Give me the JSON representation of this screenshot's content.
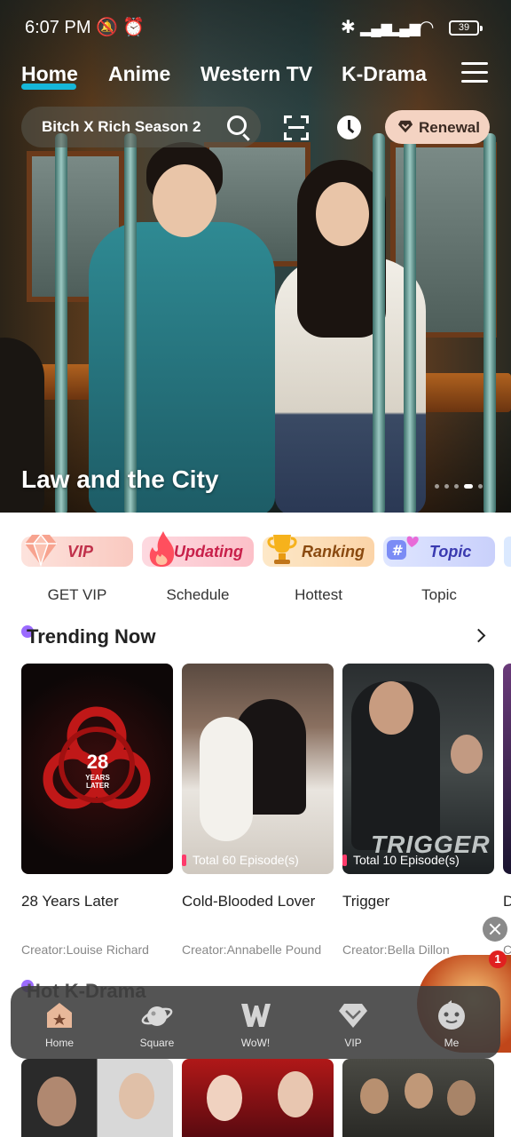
{
  "status_bar": {
    "time": "6:07 PM",
    "battery": "39"
  },
  "top_nav": {
    "tabs": [
      "Home",
      "Anime",
      "Western TV",
      "K-Drama"
    ],
    "active_tab": "Home"
  },
  "search": {
    "query": "Bitch X Rich Season 2"
  },
  "renewal_button": {
    "label": "Renewal"
  },
  "hero": {
    "title": "Law and the City",
    "slide_count": 5,
    "active_slide": 4
  },
  "quick_links": [
    {
      "badge": "VIP",
      "label": "GET VIP",
      "icon": "diamond-icon"
    },
    {
      "badge": "Updating",
      "label": "Schedule",
      "icon": "flame-icon"
    },
    {
      "badge": "Ranking",
      "label": "Hottest",
      "icon": "trophy-icon"
    },
    {
      "badge": "Topic",
      "label": "Topic",
      "icon": "hashtag-heart-icon"
    }
  ],
  "trending": {
    "title": "Trending Now",
    "items": [
      {
        "title": "28 Years Later",
        "creator": "Creator:Louise Richard",
        "badge": "",
        "poster_text": "28\nYEARS\nLATER"
      },
      {
        "title": "Cold-Blooded Lover",
        "creator": "Creator:Annabelle Pound",
        "badge": "Total 60 Episode(s)",
        "poster_text": ""
      },
      {
        "title": "Trigger",
        "creator": "Creator:Bella Dillon",
        "badge": "Total 10 Episode(s)",
        "poster_text": "TRIGGER"
      }
    ],
    "partial_next": {
      "title": "D",
      "creator": "C"
    }
  },
  "hot_section": {
    "title": "Hot K-Drama"
  },
  "floating": {
    "badge_count": "1"
  },
  "bottom_nav": [
    {
      "label": "Home",
      "icon": "home-icon"
    },
    {
      "label": "Square",
      "icon": "planet-icon"
    },
    {
      "label": "WoW!",
      "icon": "wow-icon"
    },
    {
      "label": "VIP",
      "icon": "vip-diamond-icon"
    },
    {
      "label": "Me",
      "icon": "face-icon"
    }
  ],
  "colors": {
    "accent": "#16b7d9",
    "renewal_bg": "#f4d3c2",
    "section_dot": "#9b6bff",
    "episode_marker": "#ff3b6b"
  }
}
